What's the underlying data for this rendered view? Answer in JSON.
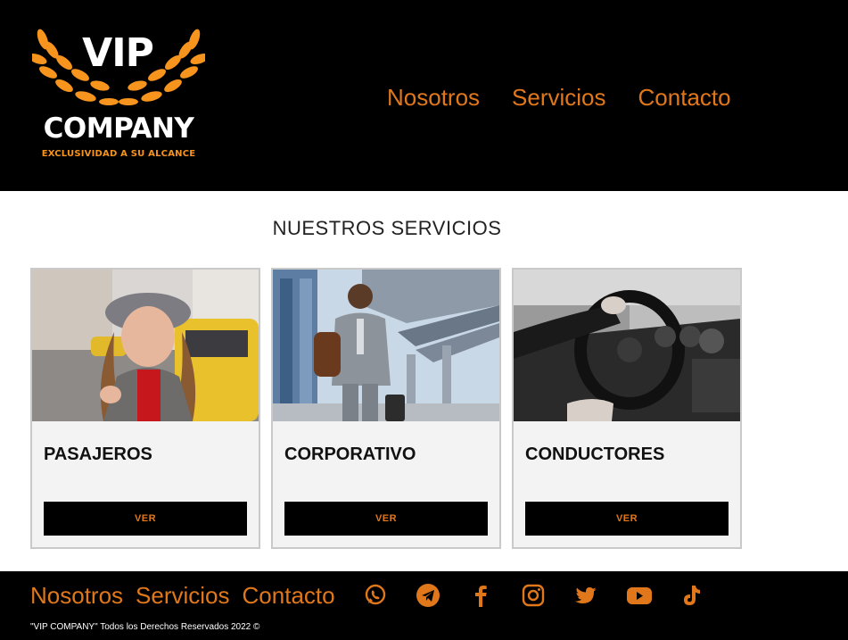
{
  "brand": {
    "name_line1": "VIP",
    "name_line2": "COMPANY",
    "tagline": "EXCLUSIVIDAD A SU ALCANCE"
  },
  "nav": {
    "items": [
      "Nosotros",
      "Servicios",
      "Contacto"
    ]
  },
  "main": {
    "section_title": "NUESTROS SERVICIOS",
    "cards": [
      {
        "title": "PASAJEROS",
        "button": "VER"
      },
      {
        "title": "CORPORATIVO",
        "button": "VER"
      },
      {
        "title": "CONDUCTORES",
        "button": "VER"
      }
    ]
  },
  "footer": {
    "nav": [
      "Nosotros",
      "Servicios",
      "Contacto"
    ],
    "social_icons": [
      "whatsapp-icon",
      "telegram-icon",
      "facebook-icon",
      "instagram-icon",
      "twitter-icon",
      "youtube-icon",
      "tiktok-icon"
    ],
    "copyright": "\"VIP COMPANY\" Todos los Derechos Reservados 2022 ©"
  },
  "colors": {
    "accent": "#e0781b",
    "laurel": "#f7941d",
    "background_dark": "#000000",
    "card_bg": "#f3f3f3"
  }
}
